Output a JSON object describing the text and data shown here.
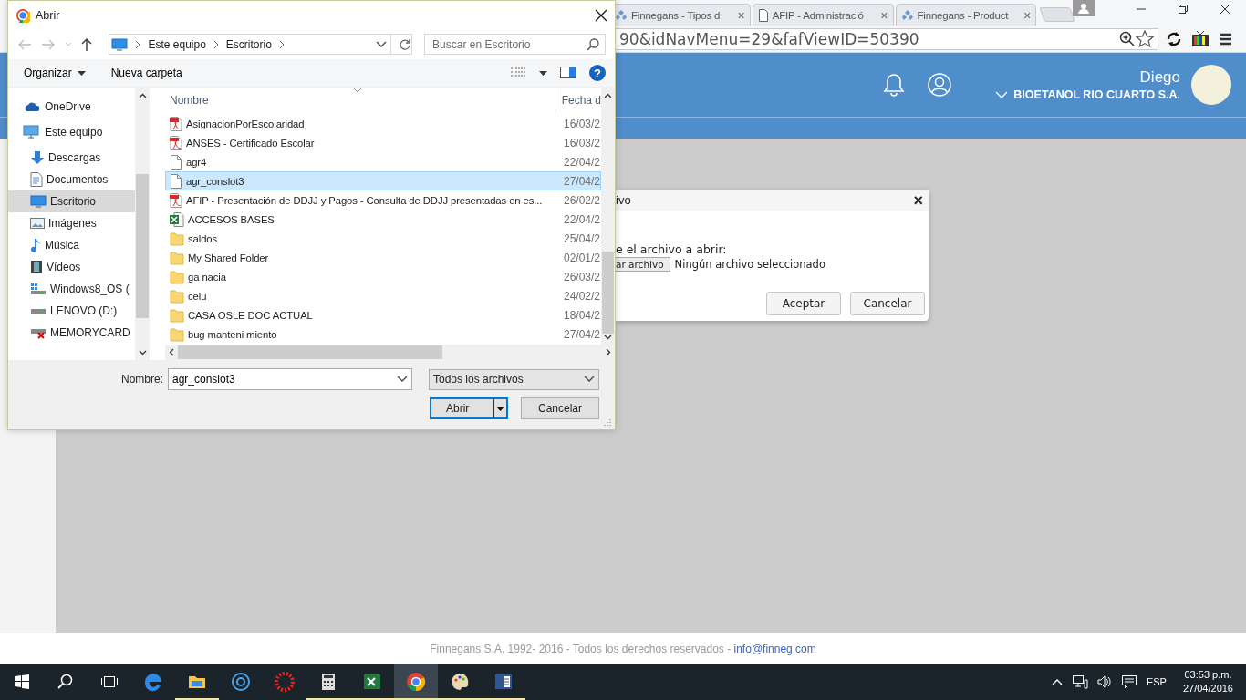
{
  "browser": {
    "tabs": [
      {
        "title": "Finnegans - Tipos d",
        "kind": "finnegans",
        "close": "×"
      },
      {
        "title": "AFIP - Administració",
        "kind": "page",
        "close": "×"
      },
      {
        "title": "Finnegans - Product",
        "kind": "finnegans",
        "close": "×"
      }
    ],
    "address": "90&idNavMenu=29&fafViewID=50390"
  },
  "app": {
    "user_name": "Diego",
    "company": "BIOETANOL RIO CUARTO S.A."
  },
  "web_modal": {
    "title": "ivo",
    "close": "×",
    "prompt": "e el archivo a abrir:",
    "file_button": "ar archivo",
    "file_status": "Ningún archivo seleccionado",
    "buttons": [
      "Aceptar",
      "Cancelar"
    ]
  },
  "footer": {
    "text": "Finnegans S.A. 1992- 2016 - Todos los derechos reservados - ",
    "link": "info@finneg.com"
  },
  "dialog": {
    "title": "Abrir",
    "breadcrumb": [
      "Este equipo",
      "Escritorio"
    ],
    "search_placeholder": "Buscar en Escritorio",
    "commands": [
      "Organizar",
      "Nueva carpeta"
    ],
    "help": "?",
    "sidebar": [
      {
        "label": "OneDrive",
        "kind": "onedrive",
        "selected": false
      },
      {
        "label": "Este equipo",
        "kind": "pc",
        "selected": false,
        "children": [
          {
            "label": "Descargas",
            "kind": "download",
            "selected": false
          },
          {
            "label": "Documentos",
            "kind": "docs",
            "selected": false
          },
          {
            "label": "Escritorio",
            "kind": "desktop",
            "selected": true
          },
          {
            "label": "Imágenes",
            "kind": "images",
            "selected": false
          },
          {
            "label": "Música",
            "kind": "music",
            "selected": false
          },
          {
            "label": "Vídeos",
            "kind": "videos",
            "selected": false
          },
          {
            "label": "Windows8_OS (",
            "kind": "windrive",
            "selected": false
          },
          {
            "label": "LENOVO (D:)",
            "kind": "drive",
            "selected": false
          },
          {
            "label": "MEMORYCARD",
            "kind": "carderror",
            "selected": false
          }
        ]
      }
    ],
    "columns": [
      "Nombre",
      "Fecha d"
    ],
    "files": [
      {
        "name": "AsignacionPorEscolaridad",
        "date": "16/03/2",
        "kind": "pdf",
        "selected": false
      },
      {
        "name": "ANSES - Certificado Escolar",
        "date": "16/03/2",
        "kind": "pdf",
        "selected": false
      },
      {
        "name": "agr4",
        "date": "22/04/2",
        "kind": "file",
        "selected": false
      },
      {
        "name": "agr_conslot3",
        "date": "27/04/2",
        "kind": "file",
        "selected": true
      },
      {
        "name": "AFIP - Presentación de DDJJ y Pagos - Consulta de DDJJ presentadas en es...",
        "date": "26/02/2",
        "kind": "pdf",
        "selected": false
      },
      {
        "name": "ACCESOS BASES",
        "date": "22/04/2",
        "kind": "excel",
        "selected": false
      },
      {
        "name": "saldos",
        "date": "25/04/2",
        "kind": "folder",
        "selected": false
      },
      {
        "name": "My Shared Folder",
        "date": "02/01/2",
        "kind": "folder",
        "selected": false
      },
      {
        "name": "ga nacia",
        "date": "26/03/2",
        "kind": "folder",
        "selected": false
      },
      {
        "name": "celu",
        "date": "24/02/2",
        "kind": "folder",
        "selected": false
      },
      {
        "name": "CASA OSLE DOC ACTUAL",
        "date": "18/04/2",
        "kind": "folder",
        "selected": false
      },
      {
        "name": "bug manteni miento",
        "date": "27/04/2",
        "kind": "folder",
        "selected": false
      }
    ],
    "name_label": "Nombre:",
    "file_name": "agr_conslot3",
    "file_type": "Todos los archivos",
    "buttons": [
      "Abrir",
      "Cancelar"
    ]
  },
  "taskbar": {
    "apps": [
      {
        "kind": "edge",
        "running": false,
        "active": false
      },
      {
        "kind": "explorer",
        "running": true,
        "active": false
      },
      {
        "kind": "gauge",
        "running": false,
        "active": false
      },
      {
        "kind": "dots",
        "running": false,
        "active": false
      },
      {
        "kind": "calculator",
        "running": true,
        "active": false
      },
      {
        "kind": "excel",
        "running": true,
        "active": false
      },
      {
        "kind": "chrome",
        "running": true,
        "active": true
      },
      {
        "kind": "paint",
        "running": true,
        "active": false
      },
      {
        "kind": "word",
        "running": true,
        "active": false
      }
    ],
    "language": "ESP",
    "time": "03:53 p.m.",
    "date": "27/04/2016"
  }
}
